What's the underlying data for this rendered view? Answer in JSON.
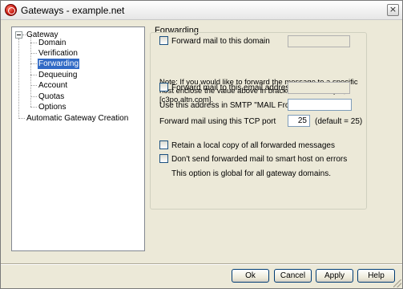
{
  "window": {
    "title": "Gateways - example.net",
    "close_glyph": "×"
  },
  "tree": {
    "items": [
      {
        "label": "Gateway"
      },
      {
        "label": "Domain"
      },
      {
        "label": "Verification"
      },
      {
        "label": "Forwarding",
        "selected": true
      },
      {
        "label": "Dequeuing"
      },
      {
        "label": "Account"
      },
      {
        "label": "Quotas"
      },
      {
        "label": "Options"
      },
      {
        "label": "Automatic Gateway Creation"
      }
    ]
  },
  "forwarding": {
    "group_title": "Forwarding",
    "forward_domain_label": "Forward mail to this domain",
    "forward_domain_checked": false,
    "forward_domain_value": "",
    "note": "Note:  If you would like to forward the message to a specific host enclose the value above in brackets.  For example, [c3po.altn.com].",
    "forward_email_label": "Forward mail to this email address",
    "forward_email_checked": false,
    "forward_email_value": "",
    "smtp_from_label": "Use this address in SMTP \"MAIL From\"",
    "smtp_from_value": "",
    "tcp_port_label": "Forward mail using this TCP port",
    "tcp_port_value": "25",
    "tcp_port_default": "(default = 25)",
    "retain_copy_label": "Retain a local copy of all forwarded messages",
    "retain_copy_checked": false,
    "no_smarthost_label": "Don't send forwarded mail to smart host on errors",
    "no_smarthost_checked": false,
    "global_note": "This option is global for all gateway domains."
  },
  "buttons": {
    "ok": "Ok",
    "cancel": "Cancel",
    "apply": "Apply",
    "help": "Help"
  },
  "colors": {
    "selection": "#316ac5",
    "dialog_bg": "#ece9d8",
    "accent_icon": "#c4140c"
  },
  "icons": {
    "app": "mdaemon-logo-icon",
    "close": "close-icon"
  }
}
